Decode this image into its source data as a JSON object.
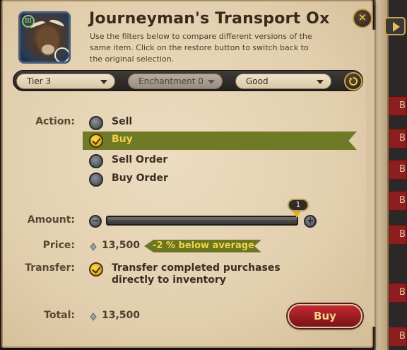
{
  "item": {
    "title": "Journeyman's Transport Ox",
    "description": "Use the filters below to compare different versions of the same item. Click on the restore button to switch back to the original selection.",
    "tier_badge": "III"
  },
  "filters": {
    "tier": "Tier 3",
    "enchantment": "Enchantment 0",
    "quality": "Good"
  },
  "action": {
    "label": "Action:",
    "options": [
      {
        "label": "Sell",
        "checked": false
      },
      {
        "label": "Buy",
        "checked": true
      },
      {
        "label": "Sell Order",
        "checked": false
      },
      {
        "label": "Buy Order",
        "checked": false
      }
    ]
  },
  "amount": {
    "label": "Amount:",
    "value": "1",
    "minus_icon": "minus-icon",
    "plus_icon": "plus-icon",
    "fill_fraction": 1.0
  },
  "price": {
    "label": "Price:",
    "value": "13,500",
    "comparison": "-2 % below average"
  },
  "transfer": {
    "label": "Transfer:",
    "text": "Transfer completed purchases directly to inventory",
    "checked": true
  },
  "total": {
    "label": "Total:",
    "value": "13,500"
  },
  "buy_button": "Buy",
  "background": {
    "side_buttons": [
      "B",
      "B",
      "B",
      "B",
      "B",
      "B",
      "B"
    ]
  },
  "colors": {
    "selected_row": "#6f7a26",
    "selected_text": "#f2d34a",
    "buy_button": "#c42a30",
    "accent_gold": "#c9a24a"
  }
}
